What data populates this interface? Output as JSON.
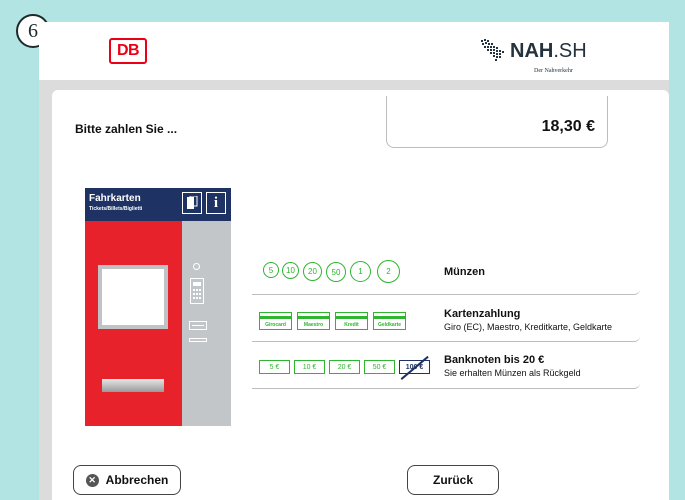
{
  "step": {
    "number": "6"
  },
  "header": {
    "db_logo": "DB",
    "nah_logo": {
      "brand": "NAH",
      "suffix": ".SH",
      "tagline": "Der Nahverkehr"
    }
  },
  "payment": {
    "prompt": "Bitte zahlen Sie ...",
    "amount": "18,30 €"
  },
  "machine": {
    "title": "Fahrkarten",
    "subtitle": "Tickets/Billets/Biglietti",
    "info_icon": "i"
  },
  "methods": {
    "coins": {
      "values": [
        "5",
        "10",
        "20",
        "50",
        "1",
        "2"
      ],
      "title": "Münzen"
    },
    "cards": {
      "types": [
        "Girocard",
        "Maestro",
        "Kredit",
        "Geldkarte"
      ],
      "title": "Kartenzahlung",
      "description": "Giro (EC), Maestro, Kreditkarte, Geldkarte"
    },
    "notes": {
      "values": [
        "5 €",
        "10 €",
        "20 €",
        "50 €",
        "100 €"
      ],
      "title": "Banknoten bis 20 €",
      "description": "Sie erhalten Münzen als Rückgeld"
    }
  },
  "buttons": {
    "cancel": "Abbrechen",
    "back": "Zurück"
  },
  "colors": {
    "background": "#b3e4e4",
    "db_red": "#ec0016",
    "accent_green": "#2fb52f",
    "machine_blue": "#1e3363"
  }
}
